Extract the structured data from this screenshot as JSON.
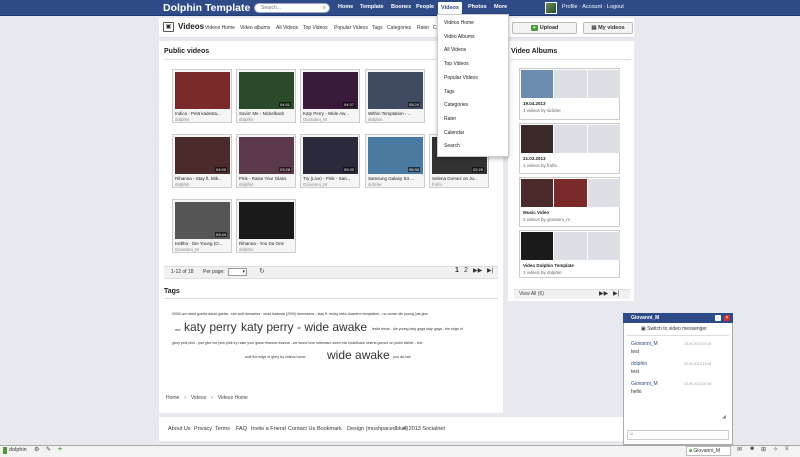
{
  "topbar": {
    "logo": "Dolphin Template",
    "search_placeholder": "Search...",
    "nav": [
      "Home",
      "Template",
      "Boonex",
      "People",
      "Videos",
      "Photos",
      "More"
    ],
    "profile_links": "Profile · Account · Logout"
  },
  "subheader": {
    "title": "Videos",
    "links": [
      "Videos Home",
      "Video albums",
      "All Videos",
      "Top Videos",
      "Popular Videos",
      "Tags",
      "Categories",
      "Rater",
      "C"
    ],
    "upload_label": "Upload",
    "my_videos_label": "My videos"
  },
  "dropdown": [
    "Videos Home",
    "Video Albums",
    "All Videos",
    "Top Videos",
    "Popular Videos",
    "Tags",
    "Categories",
    "Rater",
    "Calendar",
    "Search"
  ],
  "public_videos": {
    "title": "Public videos",
    "videos": [
      {
        "title": "Indica - Pelä kadesta...",
        "author": "dolphin",
        "duration": ""
      },
      {
        "title": "Savin' Me - Nickelback",
        "author": "dolphin",
        "duration": "04:51"
      },
      {
        "title": "Katy Perry - Wide Aw...",
        "author": "Giovanni_M",
        "duration": "04:37"
      },
      {
        "title": "Within Temptation - ...",
        "author": "dolphin",
        "duration": "05:24"
      },
      {
        "title": "",
        "author": "",
        "duration": ""
      },
      {
        "title": "Rihanna - Stay ft. Mik...",
        "author": "dolphin",
        "duration": "04:00"
      },
      {
        "title": "Pink - Raise Your Glass",
        "author": "dolphin",
        "duration": "03:28"
      },
      {
        "title": "Try (Live) - Pink - San...",
        "author": "Giovanni_M",
        "duration": "05:30"
      },
      {
        "title": "Samsung Galaxy S4 ...",
        "author": "sidiclei",
        "duration": "06:30"
      },
      {
        "title": "Selena Gomez on Ju...",
        "author": "frulfo",
        "duration": "02:25"
      },
      {
        "title": "Ke$ha - Die Young (O...",
        "author": "Giovanni_M",
        "duration": "03:44"
      },
      {
        "title": "Rihanna - You Da One",
        "author": "dolphin",
        "duration": ""
      }
    ]
  },
  "pager": {
    "range": "1-12 of 18",
    "per_page_label": "Per page:",
    "per_page_value": "",
    "pages": [
      "1",
      "2"
    ]
  },
  "tags": {
    "title": "Tags",
    "line1": "2000\\.avi  david guetta  david guetta - she wolf  demarina - onda kadesta (2000)  demeanna - stay ft. micky ekko  downfrm temptation - no ocean  die young  just give",
    "line2a": "me",
    "big1": "katy perry",
    "big2": "katy perry - wide awake",
    "line2b": "leslie  leshe - die young  lady gaga  lady gaga - the edge of",
    "line3": "glory  pink  pink - just give me  pink pink  try  raise your glass  rihanna  rihanna - we found love  rotterdam  swim  mix  nickelback  selena gomez on justin bieber - she",
    "line4a": "wolf  the edge of glory  try  videos home",
    "big3": "wide awake",
    "line4b": "you da one"
  },
  "breadcrumb": [
    "Home",
    "Videos",
    "Videos Home"
  ],
  "video_albums": {
    "title": "Video Albums",
    "albums": [
      {
        "title": "19.04.2013",
        "sub": "1 videos by sidiclei"
      },
      {
        "title": "21.03.2013",
        "sub": "1 videos by frulfo"
      },
      {
        "title": "Music Video",
        "sub": "2 videos by giovanni_m"
      },
      {
        "title": "Video Dolphin Template",
        "sub": "1 videos by dolphin"
      }
    ],
    "view_all": "View All (6)"
  },
  "footer": [
    "About Us",
    "Privacy",
    "Terms",
    "FAQ",
    "Invite a Friend",
    "Contact Us",
    "Bookmark",
    "Design (mushpacedblue)"
  ],
  "copyright": "© 2013 Socialnet",
  "chat": {
    "user": "Giovanni_M",
    "switch": "Switch to video messenger",
    "messages": [
      {
        "name": "Giovanni_M",
        "time": "19.04.2013 19:25",
        "text": "test"
      },
      {
        "name": "dolphin",
        "time": "20.04.2013 13:50",
        "text": "test"
      },
      {
        "name": "Giovanni_M",
        "time": "22.05.2013 20:26",
        "text": "hello"
      }
    ]
  },
  "bottombar": {
    "user": "dolphin",
    "chat_user": "Giovanni_M"
  }
}
